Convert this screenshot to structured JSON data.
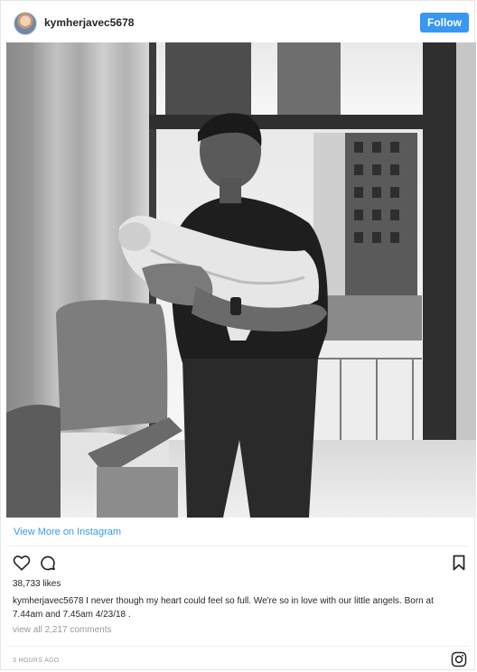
{
  "header": {
    "username": "kymherjavec5678",
    "follow_label": "Follow"
  },
  "post": {
    "view_more_label": "View More on Instagram",
    "likes": "38,733 likes",
    "caption_user": "kymherjavec5678",
    "caption_text": "I never though my heart could feel so full. We're so in love with our little angels. Born at 7.44am and 7.45am 4/23/18 .",
    "view_comments": "view all 2,217 comments",
    "timestamp": "3 HOURS AGO"
  },
  "colors": {
    "accent": "#3897f0",
    "text": "#262626",
    "muted": "#999999"
  },
  "icons": {
    "heart": "heart-icon",
    "comment": "comment-icon",
    "bookmark": "bookmark-icon",
    "instagram": "instagram-logo-icon"
  }
}
